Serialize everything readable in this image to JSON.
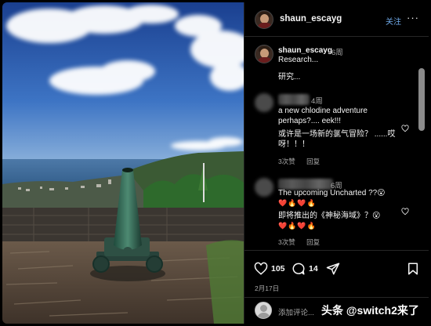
{
  "post": {
    "username": "shaun_escayg",
    "follow_label": "关注",
    "more_label": "···"
  },
  "caption": {
    "username": "shaun_escayg",
    "time": "6周",
    "line1": "Research...",
    "line2": "研究..."
  },
  "comments": [
    {
      "time": "4周",
      "text_lines": [
        "a new chlodine adventure",
        "perhaps?.... eek!!!",
        "或许是一场新的氯气冒险？ ......哎",
        "呀！！！"
      ],
      "likes": "3次赞",
      "reply": "回复"
    },
    {
      "time": "6周",
      "text_lines": [
        "The upcoming Uncharted ??😮",
        "❤️🔥❤️🔥",
        "即将推出的《神秘海域》？😮",
        "❤️🔥❤️🔥"
      ],
      "likes": "3次赞",
      "reply": "回复"
    }
  ],
  "actions": {
    "likes": "105",
    "comments": "14",
    "date": "2月17日"
  },
  "add_comment": {
    "placeholder": "添加评论..."
  },
  "watermark": "头条 @switch2来了",
  "colors": {
    "background": "#000000",
    "link_blue": "#6fa9e8",
    "muted_text": "#a8a8a8"
  }
}
